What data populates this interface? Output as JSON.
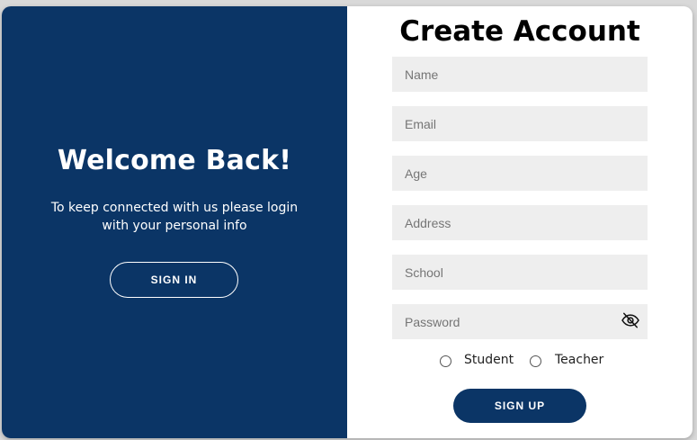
{
  "left_panel": {
    "title": "Welcome Back!",
    "text": "To keep connected with us please login with your personal info",
    "signin_label": "SIGN IN"
  },
  "right_panel": {
    "title": "Create Account",
    "fields": {
      "name_placeholder": "Name",
      "email_placeholder": "Email",
      "age_placeholder": "Age",
      "address_placeholder": "Address",
      "school_placeholder": "School",
      "password_placeholder": "Password"
    },
    "password_toggle_icon": "eye-slash-icon",
    "roles": [
      "Student",
      "Teacher"
    ],
    "signup_label": "SIGN UP"
  },
  "colors": {
    "primary": "#0b3566",
    "field_bg": "#eeeeee",
    "page_bg": "#d9d9d9"
  }
}
